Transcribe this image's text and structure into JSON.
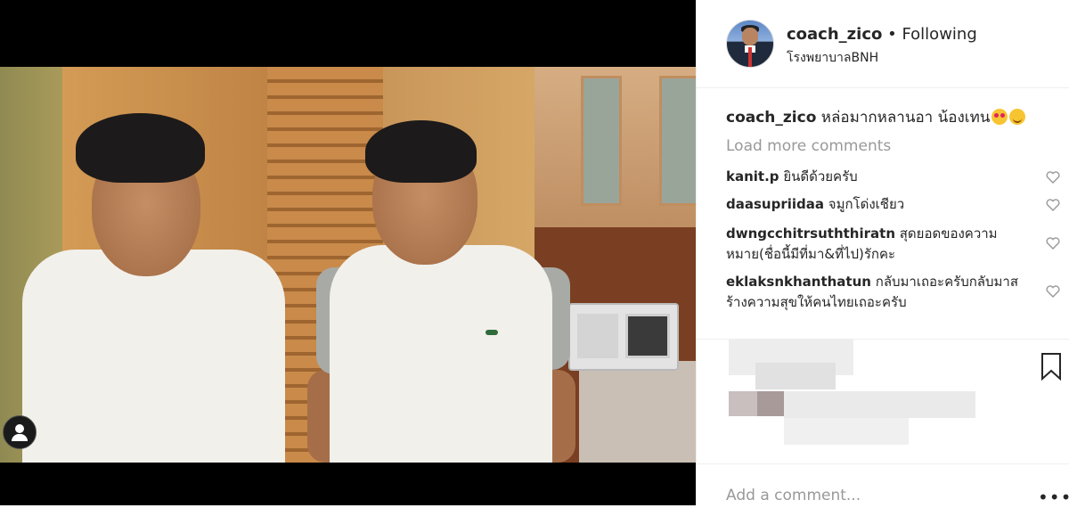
{
  "post": {
    "username": "coach_zico",
    "separator": "•",
    "follow_state": "Following",
    "location": "โรงพยาบาลBNH"
  },
  "caption": {
    "username": "coach_zico",
    "text": "หล่อมากหลานอา น้องเทน",
    "emojis": [
      "star-struck-emoji",
      "smiling-face-emoji"
    ]
  },
  "load_more": "Load more comments",
  "comments": [
    {
      "username": "kanit.p",
      "text": "ยินดีด้วยครับ"
    },
    {
      "username": "daasupriidaa",
      "text": "จมูกโด่งเชียว"
    },
    {
      "username": "dwngcchitrsuththiratn",
      "text": "สุดยอดของความหมาย(ชื่อนี้มีที่มา&ที่ไป)รักคะ"
    },
    {
      "username": "eklaksnkhanthatun",
      "text": "กลับมาเถอะครับกลับมาสร้างความสุขให้คนไทยเถอะครับ"
    }
  ],
  "add_comment": {
    "placeholder": "Add a comment...",
    "more": "•••"
  },
  "colors": {
    "text": "#262626",
    "muted": "#999999",
    "divider": "#efefef"
  }
}
